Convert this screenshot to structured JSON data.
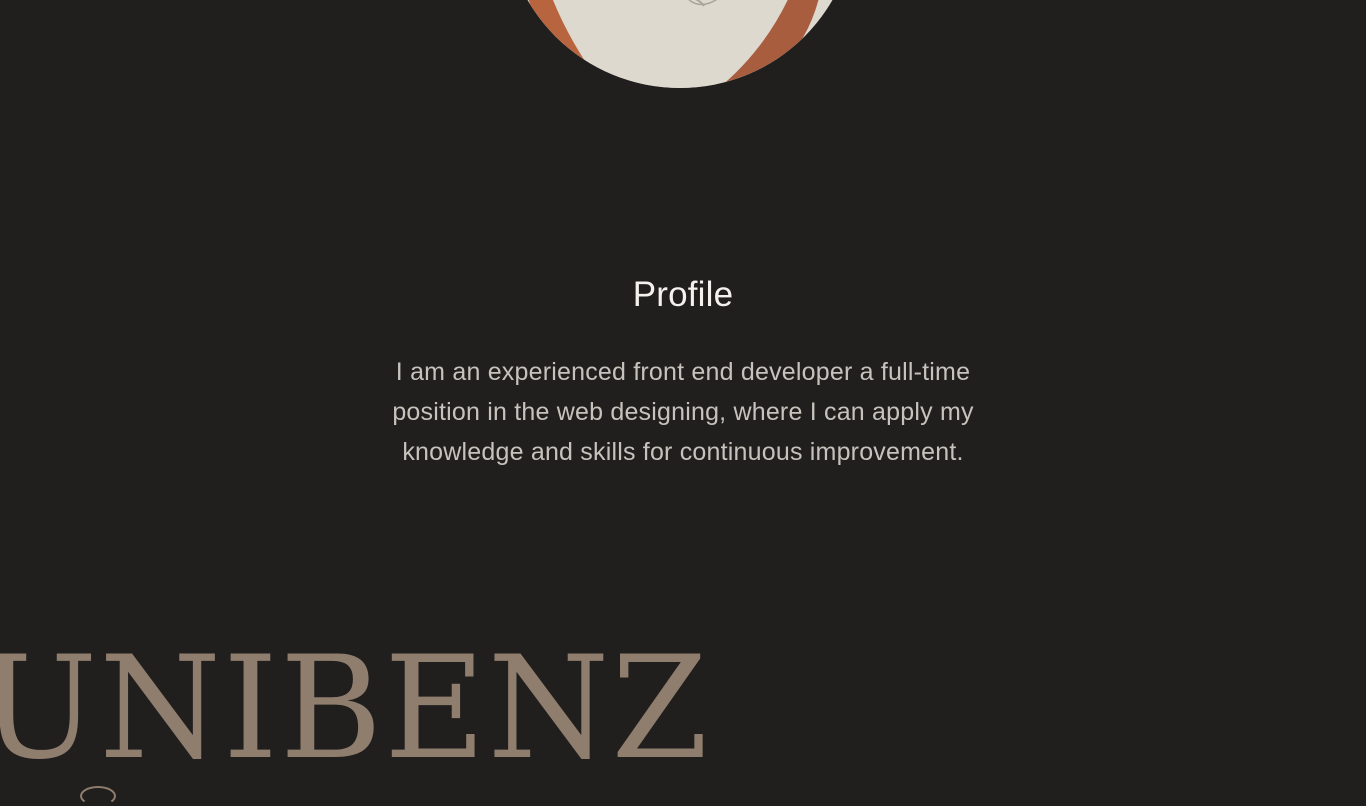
{
  "profile": {
    "title": "Profile",
    "description": "I am an experienced front end developer a full-time position in the web designing, where I can apply my knowledge and skills for continuous improvement."
  },
  "footer": {
    "wordmark": "UNIBENZ"
  },
  "colors": {
    "background": "#201f1e",
    "title": "#f4f1ec",
    "body_text": "#c6c2bc",
    "wordmark": "#8f7d6d"
  }
}
